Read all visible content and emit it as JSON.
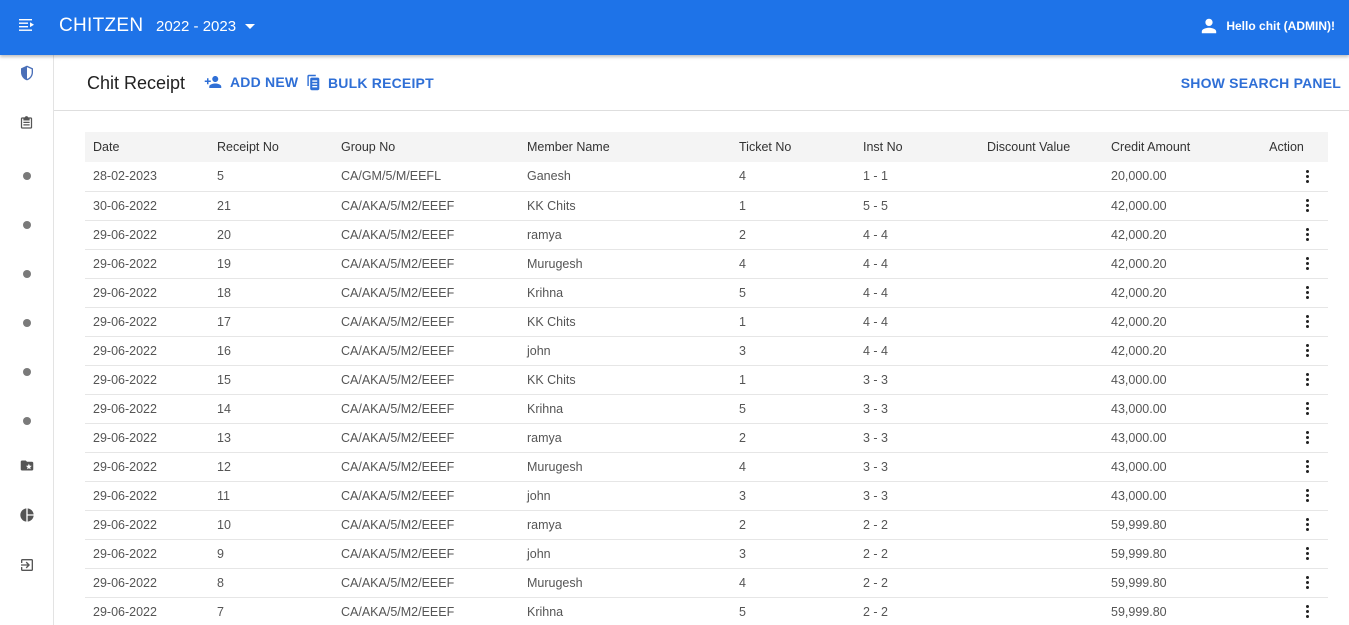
{
  "app": {
    "brand": "CHITZEN",
    "year": "2022 - 2023",
    "user_greeting": "Hello chit (ADMIN)!"
  },
  "colors": {
    "topbar": "#1e73e8",
    "accent": "#2f6fd6"
  },
  "sidebar": {
    "icons": [
      "menu-icon",
      "shield-icon",
      "clipboard-icon",
      "dot-icon",
      "dot-icon",
      "dot-icon",
      "dot-icon",
      "dot-icon",
      "dot-icon",
      "folder-star-icon",
      "pie-chart-icon",
      "logout-icon"
    ]
  },
  "header": {
    "title": "Chit Receipt",
    "add_new": "ADD NEW",
    "bulk_receipt": "BULK RECEIPT",
    "show_search_panel": "SHOW SEARCH PANEL"
  },
  "table": {
    "columns": [
      "Date",
      "Receipt No",
      "Group No",
      "Member Name",
      "Ticket No",
      "Inst No",
      "Discount Value",
      "Credit Amount",
      "Action"
    ],
    "rows": [
      [
        "28-02-2023",
        "5",
        "CA/GM/5/M/EEFL",
        "Ganesh",
        "4",
        "1 - 1",
        "",
        "20,000.00"
      ],
      [
        "30-06-2022",
        "21",
        "CA/AKA/5/M2/EEEF",
        "KK Chits",
        "1",
        "5 - 5",
        "",
        "42,000.00"
      ],
      [
        "29-06-2022",
        "20",
        "CA/AKA/5/M2/EEEF",
        "ramya",
        "2",
        "4 - 4",
        "",
        "42,000.20"
      ],
      [
        "29-06-2022",
        "19",
        "CA/AKA/5/M2/EEEF",
        "Murugesh",
        "4",
        "4 - 4",
        "",
        "42,000.20"
      ],
      [
        "29-06-2022",
        "18",
        "CA/AKA/5/M2/EEEF",
        "Krihna",
        "5",
        "4 - 4",
        "",
        "42,000.20"
      ],
      [
        "29-06-2022",
        "17",
        "CA/AKA/5/M2/EEEF",
        "KK Chits",
        "1",
        "4 - 4",
        "",
        "42,000.20"
      ],
      [
        "29-06-2022",
        "16",
        "CA/AKA/5/M2/EEEF",
        "john",
        "3",
        "4 - 4",
        "",
        "42,000.20"
      ],
      [
        "29-06-2022",
        "15",
        "CA/AKA/5/M2/EEEF",
        "KK Chits",
        "1",
        "3 - 3",
        "",
        "43,000.00"
      ],
      [
        "29-06-2022",
        "14",
        "CA/AKA/5/M2/EEEF",
        "Krihna",
        "5",
        "3 - 3",
        "",
        "43,000.00"
      ],
      [
        "29-06-2022",
        "13",
        "CA/AKA/5/M2/EEEF",
        "ramya",
        "2",
        "3 - 3",
        "",
        "43,000.00"
      ],
      [
        "29-06-2022",
        "12",
        "CA/AKA/5/M2/EEEF",
        "Murugesh",
        "4",
        "3 - 3",
        "",
        "43,000.00"
      ],
      [
        "29-06-2022",
        "11",
        "CA/AKA/5/M2/EEEF",
        "john",
        "3",
        "3 - 3",
        "",
        "43,000.00"
      ],
      [
        "29-06-2022",
        "10",
        "CA/AKA/5/M2/EEEF",
        "ramya",
        "2",
        "2 - 2",
        "",
        "59,999.80"
      ],
      [
        "29-06-2022",
        "9",
        "CA/AKA/5/M2/EEEF",
        "john",
        "3",
        "2 - 2",
        "",
        "59,999.80"
      ],
      [
        "29-06-2022",
        "8",
        "CA/AKA/5/M2/EEEF",
        "Murugesh",
        "4",
        "2 - 2",
        "",
        "59,999.80"
      ],
      [
        "29-06-2022",
        "7",
        "CA/AKA/5/M2/EEEF",
        "Krihna",
        "5",
        "2 - 2",
        "",
        "59,999.80"
      ]
    ]
  }
}
